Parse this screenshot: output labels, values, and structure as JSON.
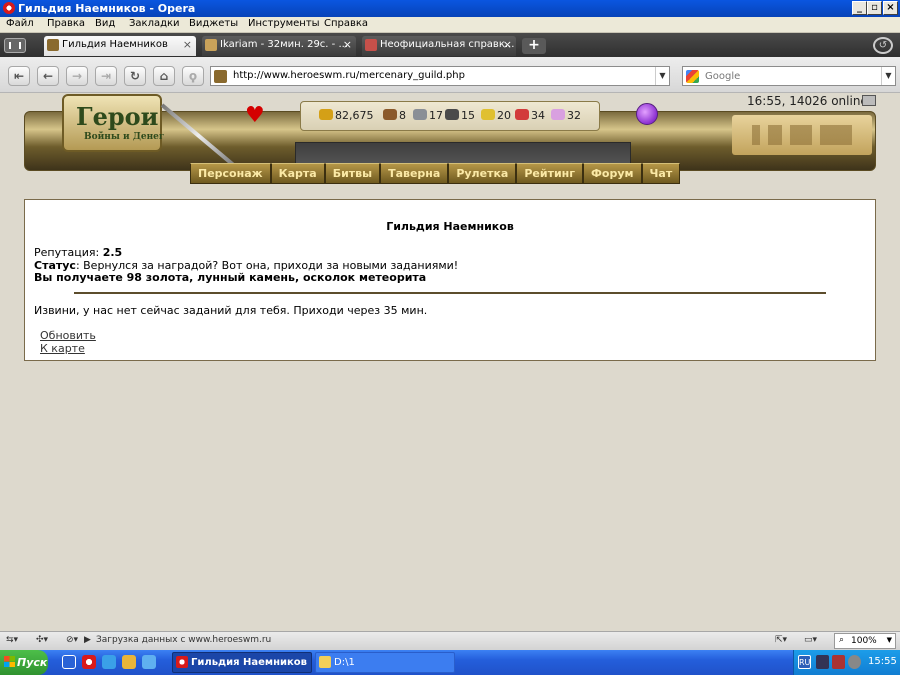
{
  "window": {
    "title": "Гильдия Наемников - Opera",
    "min": "_",
    "max": "▫",
    "close": "×"
  },
  "menu": [
    "Файл",
    "Правка",
    "Вид",
    "Закладки",
    "Виджеты",
    "Инструменты",
    "Справка"
  ],
  "tabs": [
    {
      "label": "Гильдия Наемников",
      "active": true
    },
    {
      "label": "Ikariam - 32мин. 29с. - ...",
      "active": false
    },
    {
      "label": "Неофициальная справк...",
      "active": false
    }
  ],
  "tab_close": "×",
  "new_tab": "+",
  "nav": {
    "url": "http://www.heroeswm.ru/mercenary_guild.php",
    "search_placeholder": "Google"
  },
  "game": {
    "logo_title": "Герои",
    "logo_subtitle": "Войны и Денег",
    "online_status": "16:55, 14026 online",
    "resources": [
      {
        "value": "82,675",
        "color": "#d4a017"
      },
      {
        "value": "8",
        "color": "#8b5a2b"
      },
      {
        "value": "17",
        "color": "#8a8f96"
      },
      {
        "value": "15",
        "color": "#4a4a4a"
      },
      {
        "value": "20",
        "color": "#e0c030"
      },
      {
        "value": "34",
        "color": "#d23b3b"
      },
      {
        "value": "32",
        "color": "#d9a0e0"
      }
    ],
    "nav": [
      "Персонаж",
      "Карта",
      "Битвы",
      "Таверна",
      "Рулетка",
      "Рейтинг",
      "Форум",
      "Чат"
    ]
  },
  "guild": {
    "title": "Гильдия Наемников",
    "reputation_label": "Репутация: ",
    "reputation_value": "2.5",
    "status_label": "Статус",
    "status_text": ": Вернулся за наградой? Вот она, приходи за новыми заданиями!",
    "reward_text": "Вы получаете 98 золота, лунный камень, осколок метеорита",
    "no_tasks": "Извини, у нас нет сейчас заданий для тебя. Приходи через 35 мин.",
    "refresh_link": "Обновить",
    "map_link": "К карте"
  },
  "statusbar": {
    "loading": "Загрузка данных с www.heroeswm.ru",
    "zoom": "100%"
  },
  "taskbar": {
    "start": "Пуск",
    "windows": [
      {
        "label": "Гильдия Наемников -...",
        "active": true
      },
      {
        "label": "D:\\1",
        "active": false
      }
    ],
    "lang": "RU",
    "clock": "15:55"
  }
}
